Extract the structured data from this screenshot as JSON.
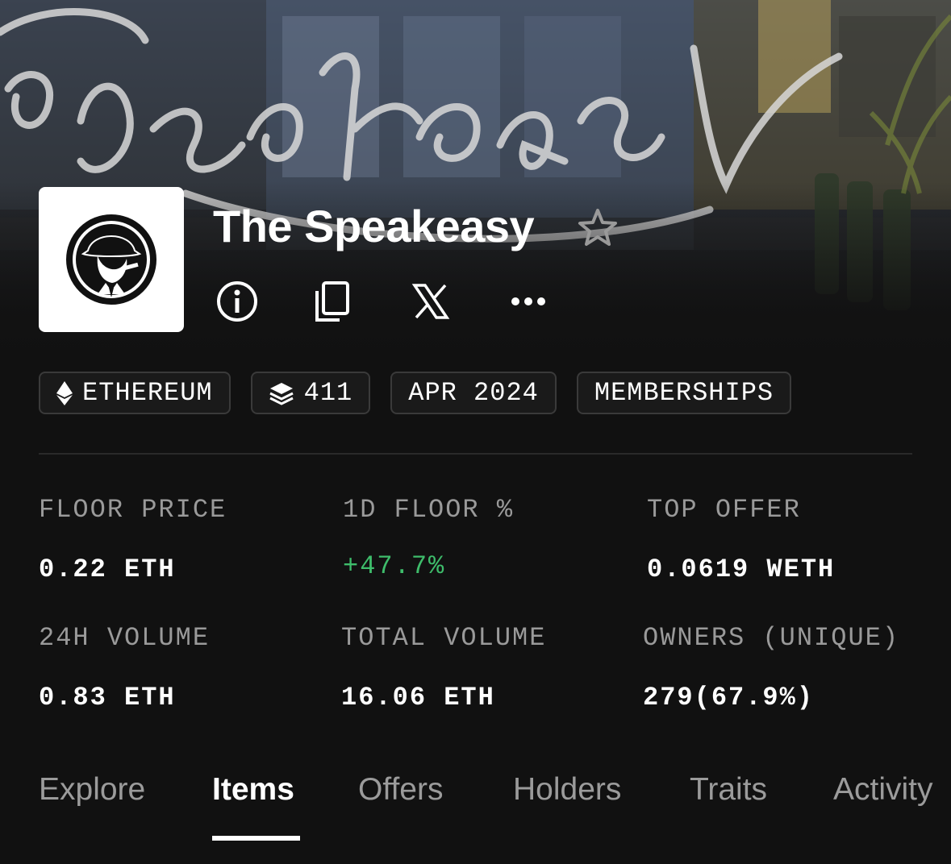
{
  "collection": {
    "name": "The Speakeasy",
    "banner_icon": "speakeasy-banner-art",
    "logo_icon": "gangster-with-fedora-and-cigar-logo"
  },
  "actions": [
    {
      "name": "info",
      "icon": "info-icon"
    },
    {
      "name": "copy",
      "icon": "copy-icon"
    },
    {
      "name": "x",
      "icon": "x-logo-icon"
    },
    {
      "name": "more",
      "icon": "more-dots-icon"
    }
  ],
  "tags": {
    "chain": "ETHEREUM",
    "items": "411",
    "date": "APR 2024",
    "category": "MEMBERSHIPS"
  },
  "stats": {
    "floor_price": {
      "label": "FLOOR PRICE",
      "value": "0.22 ETH"
    },
    "floor_change": {
      "label": "1D FLOOR %",
      "value": "+47.7%"
    },
    "top_offer": {
      "label": "TOP OFFER",
      "value": "0.0619 WETH"
    },
    "volume_24h": {
      "label": "24H VOLUME",
      "value": "0.83 ETH"
    },
    "total_volume": {
      "label": "TOTAL VOLUME",
      "value": "16.06 ETH"
    },
    "owners": {
      "label": "OWNERS (UNIQUE)",
      "value": "279(67.9%)"
    }
  },
  "tabs": [
    "Explore",
    "Items",
    "Offers",
    "Holders",
    "Traits",
    "Activity"
  ],
  "active_tab": "Items",
  "colors": {
    "background": "#111111",
    "positive": "#3ebd6b",
    "muted": "#9a9a9a"
  }
}
